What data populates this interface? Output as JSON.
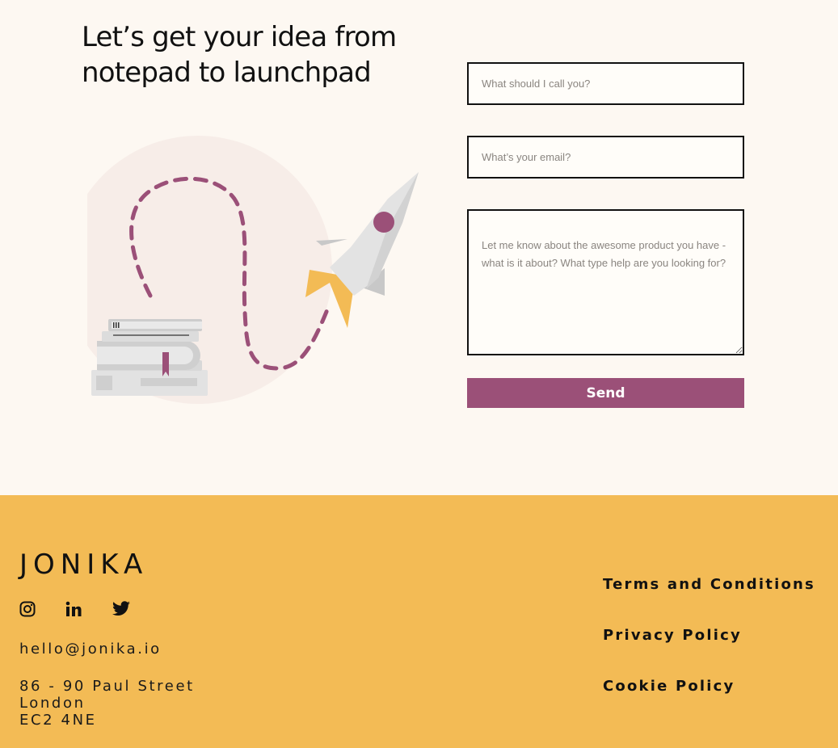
{
  "hero": {
    "title_line1": "Let’s get your idea from",
    "title_line2": "notepad to launchpad"
  },
  "form": {
    "name_placeholder": "What should I call you?",
    "email_placeholder": "What’s your email?",
    "message_placeholder": "Let me know about the awesome product you have - what is it about? What type help are you looking for?",
    "send_label": "Send"
  },
  "footer": {
    "brand": "JONIKA",
    "social": [
      "instagram-icon",
      "linkedin-icon",
      "twitter-icon"
    ],
    "email": "hello@jonika.io",
    "address": [
      "86 - 90 Paul Street",
      "London",
      "EC2 4NE"
    ],
    "links": [
      "Terms and Conditions",
      "Privacy Policy",
      "Cookie Policy"
    ]
  },
  "colors": {
    "page_background": "#fdf8f2",
    "accent": "#9b5078",
    "footer_background": "#f3bb55",
    "rocket_flame": "#f3bb55"
  }
}
